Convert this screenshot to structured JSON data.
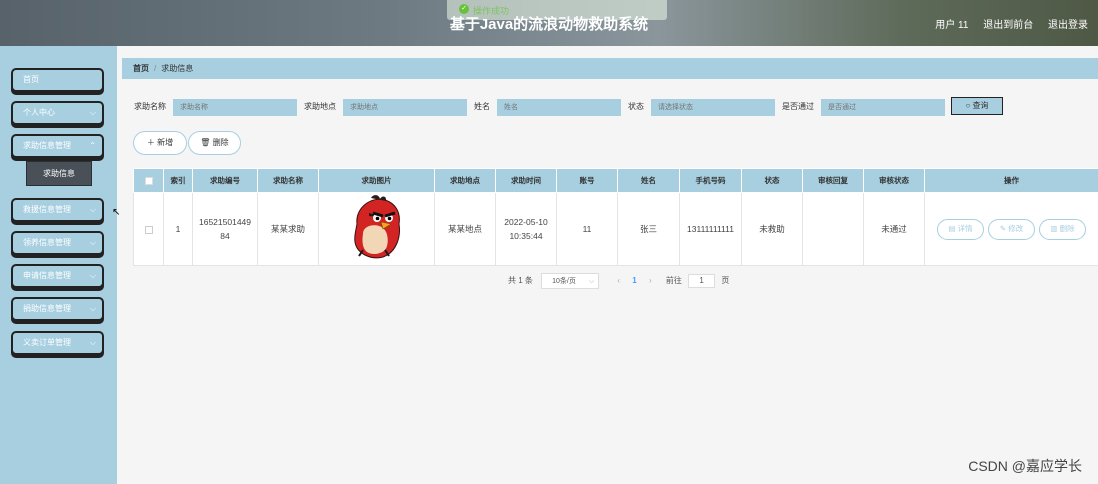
{
  "header": {
    "title": "基于Java的流浪动物救助系统",
    "toast": "操作成功",
    "user": "用户 11",
    "to_front": "退出到前台",
    "logout": "退出登录"
  },
  "sidebar": {
    "items": [
      {
        "label": "首页"
      },
      {
        "label": "个人中心"
      },
      {
        "label": "求助信息管理"
      },
      {
        "label": "救援信息管理"
      },
      {
        "label": "领养信息管理"
      },
      {
        "label": "申请信息管理"
      },
      {
        "label": "捐助信息管理"
      },
      {
        "label": "义卖订单管理"
      }
    ],
    "sub_active": "求助信息"
  },
  "breadcrumb": {
    "home": "首页",
    "current": "求助信息"
  },
  "filters": {
    "name_label": "求助名称",
    "name_ph": "求助名称",
    "place_label": "求助地点",
    "place_ph": "求助地点",
    "person_label": "姓名",
    "person_ph": "姓名",
    "status_label": "状态",
    "status_ph": "请选择状态",
    "pass_label": "是否通过",
    "pass_ph": "是否通过",
    "query": "查询"
  },
  "actions": {
    "add": "新增",
    "delete": "删除"
  },
  "table": {
    "headers": [
      "索引",
      "求助编号",
      "求助名称",
      "求助图片",
      "求助地点",
      "求助时间",
      "账号",
      "姓名",
      "手机号码",
      "状态",
      "审核回复",
      "审核状态",
      "操作"
    ],
    "rows": [
      {
        "index": "1",
        "code": "1652150144984",
        "name": "某某求助",
        "place": "某某地点",
        "time": "2022-05-10 10:35:44",
        "account": "11",
        "person": "张三",
        "phone": "13111111111",
        "status": "未救助",
        "reply": "",
        "audit": "未通过"
      }
    ],
    "op_detail": "详情",
    "op_edit": "修改",
    "op_delete": "删除"
  },
  "pager": {
    "total": "共 1 条",
    "size": "10条/页",
    "page": "1",
    "goto": "前往",
    "goto_value": "1",
    "unit": "页"
  },
  "watermark": "CSDN @嘉应学长",
  "colors": {
    "accent": "#a8cfe0",
    "header_dark": "#57626a",
    "pager_active": "#409eff"
  }
}
